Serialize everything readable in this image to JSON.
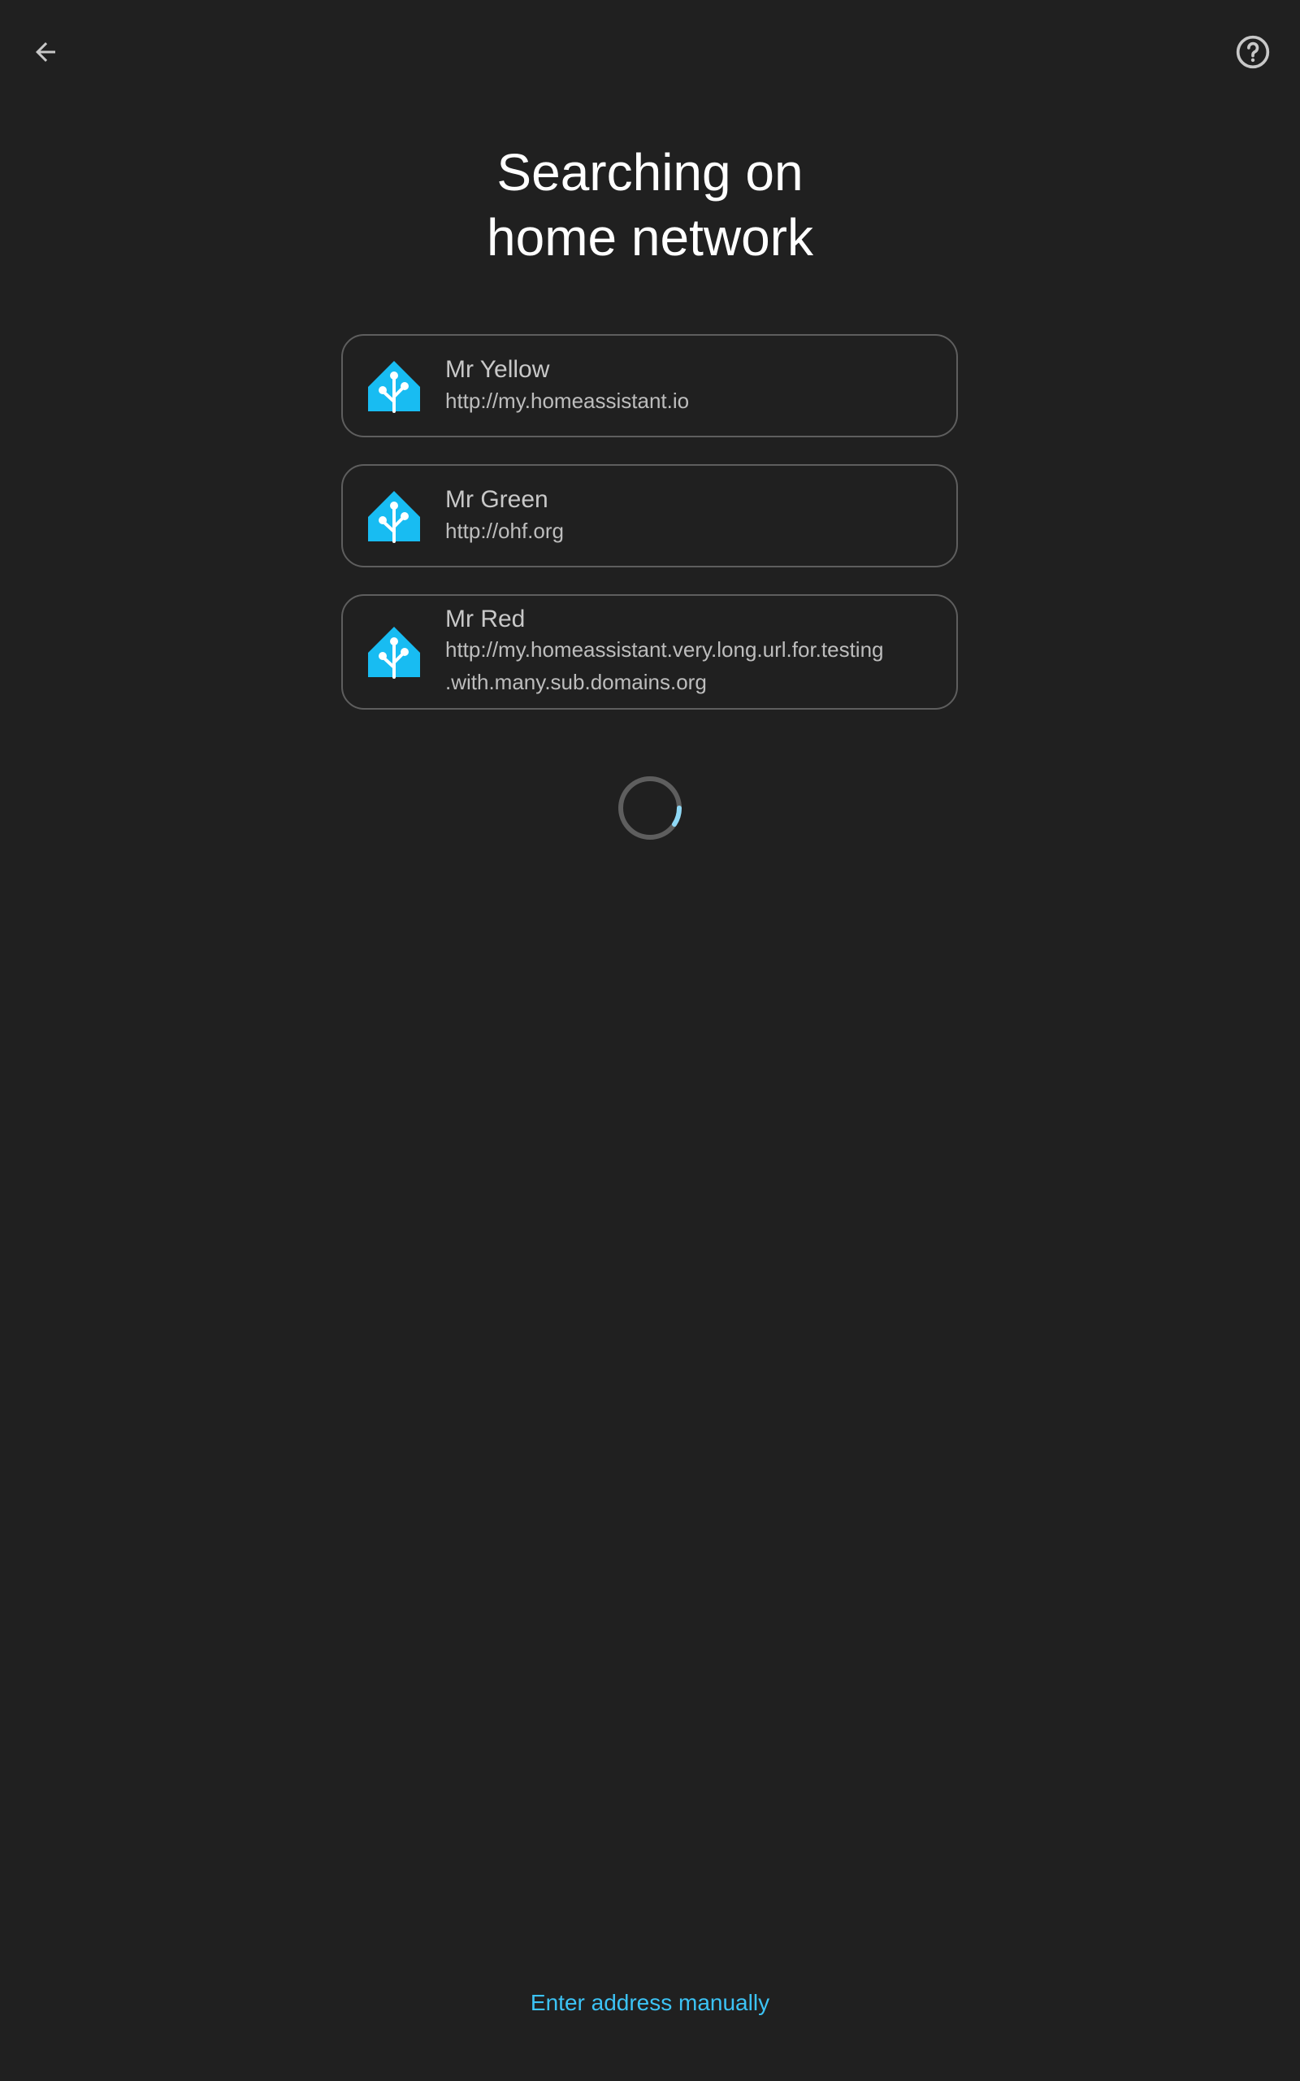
{
  "header": {
    "back_icon": "arrow-left-icon",
    "help_icon": "help-circle-icon"
  },
  "title": {
    "line1": "Searching on",
    "line2": "home network"
  },
  "servers": [
    {
      "name": "Mr Yellow",
      "url": "http://my.homeassistant.io",
      "icon": "home-assistant-logo-icon"
    },
    {
      "name": "Mr Green",
      "url": "http://ohf.org",
      "icon": "home-assistant-logo-icon"
    },
    {
      "name": "Mr Red",
      "url": "http://my.homeassistant.very.long.url.for.testing.with.many.sub.domains.org",
      "url_line1": "http://my.homeassistant.very.long.url.for.testing",
      "url_line2": ".with.many.sub.domains.org",
      "icon": "home-assistant-logo-icon"
    }
  ],
  "spinner": {
    "icon": "loading-spinner-icon"
  },
  "footer": {
    "manual_link": "Enter address manually"
  },
  "colors": {
    "background": "#202020",
    "accent": "#3cc3f5",
    "logo": "#18bcf2",
    "card_border": "#5e5e5e",
    "text_primary": "#ffffff",
    "text_secondary": "#bdbdbd"
  }
}
